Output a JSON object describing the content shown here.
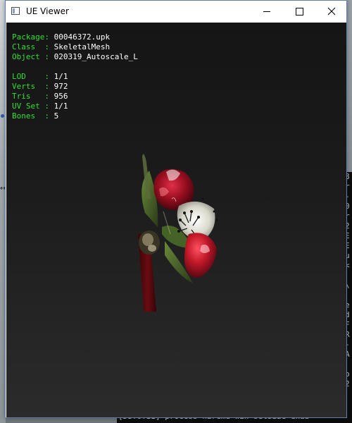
{
  "window": {
    "title": "UE Viewer",
    "controls": {
      "minimize": "minimize",
      "maximize": "maximize",
      "close": "close"
    }
  },
  "info": {
    "package_label": "Package:",
    "package_value": "00046372.upk",
    "class_label": "Class  :",
    "class_value": "SkeletalMesh",
    "object_label": "Object :",
    "object_value": "020319_Autoscale_L",
    "lod_label": "LOD    :",
    "lod_value": "1/1",
    "verts_label": "Verts  :",
    "verts_value": "972",
    "tris_label": "Tris   :",
    "tris_value": "956",
    "uvset_label": "UV Set :",
    "uvset_value": "1/1",
    "bones_label": "Bones  :",
    "bones_value": "5"
  },
  "background_console": {
    "side_lines": [
      "8",
      "r",
      "-",
      "0",
      "r",
      "2",
      "E",
      "E",
      "u",
      "<",
      "",
      "\\",
      "",
      "e",
      "d",
      "F",
      "R",
      "-",
      "A",
      "",
      "o",
      "2"
    ],
    "bottom_line": "[DSTOTII] process  niremd win setSize  enab"
  },
  "colors": {
    "label_green": "#33dd33",
    "value_white": "#ffffff",
    "viewport_bg": "#1a1a1a",
    "titlebar_bg": "#ffffff",
    "window_border": "#5d7fa8"
  },
  "icons": {
    "app": "app-window-icon",
    "minimize": "minimize-icon",
    "maximize": "maximize-icon",
    "close": "close-icon"
  }
}
